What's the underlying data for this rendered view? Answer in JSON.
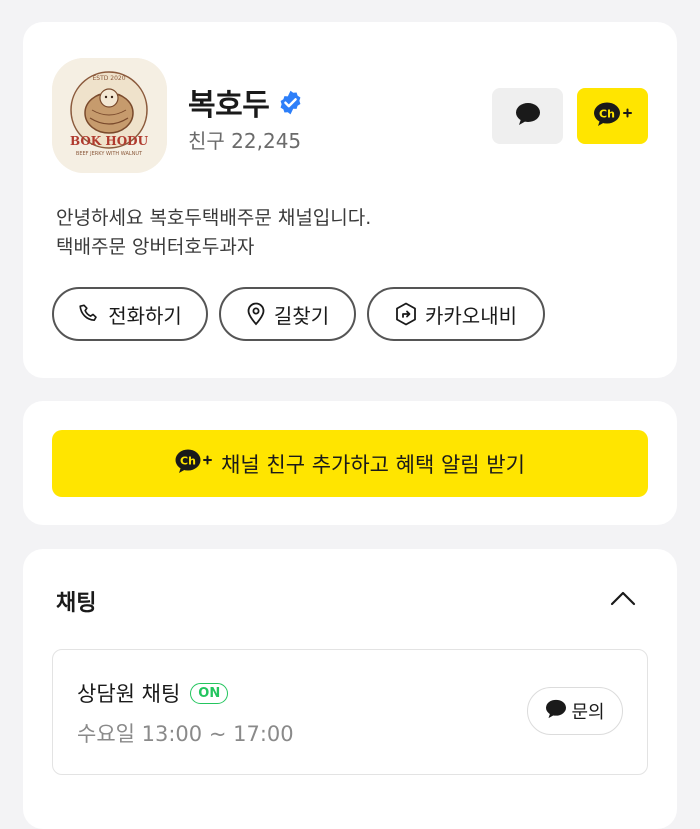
{
  "profile": {
    "name": "복호두",
    "friends": "친구 22,245",
    "description_line1": "안녕하세요 복호두택배주문 채널입니다.",
    "description_line2": "택배주문 앙버터호두과자",
    "logo": {
      "estd": "ESTD 2020",
      "brand": "BOK HODU",
      "tagline": "BEEF JERKY WITH WALNUT"
    },
    "ch_label": "Ch",
    "actions": {
      "call": "전화하기",
      "route": "길찾기",
      "navi": "카카오내비"
    }
  },
  "add_friend": {
    "label": "채널 친구 추가하고 혜택 알림 받기",
    "ch_label": "Ch"
  },
  "chat_section": {
    "title": "채팅",
    "agent": {
      "title": "상담원 채팅",
      "status": "ON",
      "hours": "수요일 13:00 ~ 17:00",
      "button": "문의"
    }
  },
  "colors": {
    "kakao_yellow": "#ffe500",
    "verified_blue": "#2d7ff9",
    "on_green": "#23c55e"
  }
}
